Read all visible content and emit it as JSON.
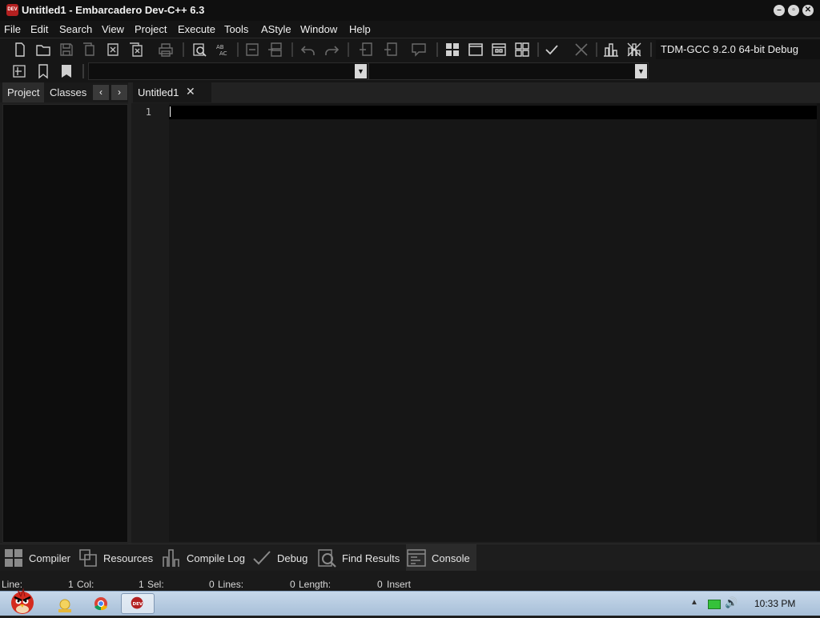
{
  "window": {
    "title": "Untitled1 - Embarcadero Dev-C++ 6.3",
    "app_icon_text": "DEV"
  },
  "menu": [
    "File",
    "Edit",
    "Search",
    "View",
    "Project",
    "Execute",
    "Tools",
    "AStyle",
    "Window",
    "Help"
  ],
  "toolbar": {
    "compiler_profile": "TDM-GCC 9.2.0 64-bit Debug"
  },
  "left_panel": {
    "tabs": [
      "Project",
      "Classes"
    ],
    "active_tab": "Project",
    "prev_label": "‹",
    "next_label": "›"
  },
  "editor": {
    "tabs": [
      {
        "label": "Untitled1",
        "close": "✕"
      }
    ],
    "line_numbers": [
      "1"
    ],
    "content": ""
  },
  "bottom_tabs": [
    "Compiler",
    "Resources",
    "Compile Log",
    "Debug",
    "Find Results",
    "Console"
  ],
  "status": {
    "line_label": "Line:",
    "line_value": "1",
    "col_label": "Col:",
    "col_value": "1",
    "sel_label": "Sel:",
    "sel_value": "0",
    "lines_label": "Lines:",
    "lines_value": "0",
    "length_label": "Length:",
    "length_value": "0",
    "mode": "Insert"
  },
  "taskbar": {
    "clock": "10:33 PM"
  },
  "colors": {
    "bg": "#1f1f1f",
    "editor_bg": "#161616",
    "active_line": "#000000",
    "accent_red": "#b32020"
  }
}
